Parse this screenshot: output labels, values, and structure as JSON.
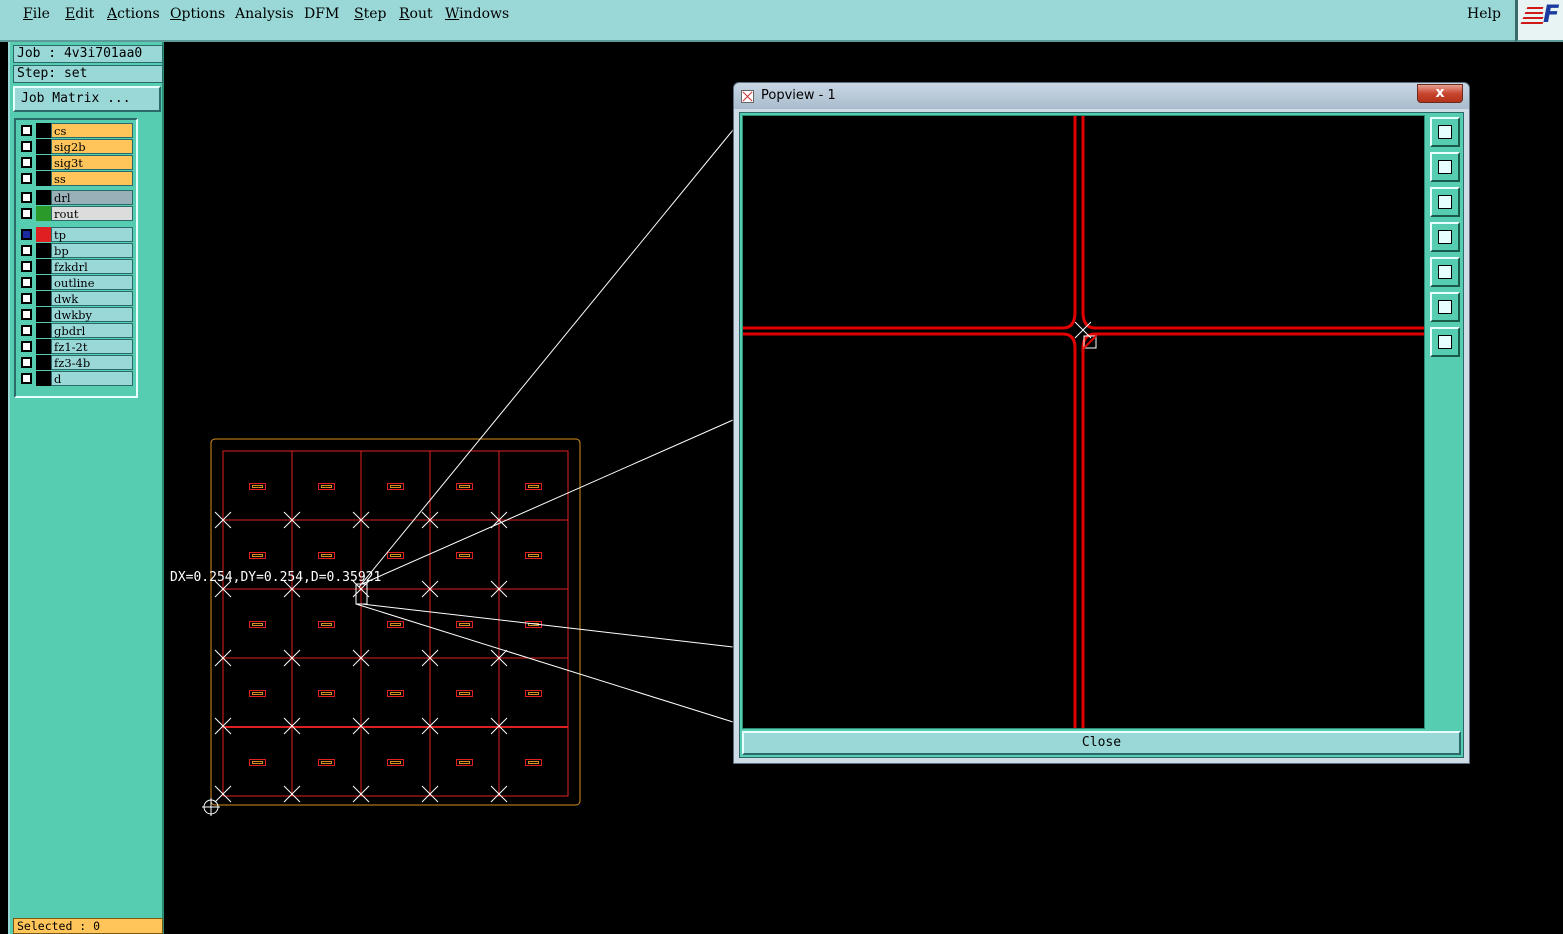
{
  "menubar": {
    "items": [
      {
        "label": "File",
        "u": "F",
        "rest": "ile"
      },
      {
        "label": "Edit",
        "u": "E",
        "rest": "dit"
      },
      {
        "label": "Actions",
        "u": "A",
        "rest": "ctions"
      },
      {
        "label": "Options",
        "u": "O",
        "rest": "ptions"
      },
      {
        "label": "Analysis",
        "u": "",
        "rest": "Analysis"
      },
      {
        "label": "DFM",
        "u": "",
        "rest": "DFM"
      },
      {
        "label": "Step",
        "u": "S",
        "rest": "tep"
      },
      {
        "label": "Rout",
        "u": "R",
        "rest": "out"
      },
      {
        "label": "Windows",
        "u": "W",
        "rest": "indows"
      }
    ],
    "help": "Help",
    "logo_text": "F"
  },
  "panel": {
    "job": "Job : 4v3i701aa0",
    "step": "Step: set",
    "job_matrix": "Job Matrix ...",
    "selected": "Selected : 0"
  },
  "layers": [
    {
      "name": "cs",
      "bg": "#ffc55a",
      "swatch": "#000000",
      "checked": false
    },
    {
      "name": "sig2b",
      "bg": "#ffc55a",
      "swatch": "#000000",
      "checked": false
    },
    {
      "name": "sig3t",
      "bg": "#ffc55a",
      "swatch": "#000000",
      "checked": false
    },
    {
      "name": "ss",
      "bg": "#ffc55a",
      "swatch": "#000000",
      "checked": false
    },
    {
      "name": "drl",
      "bg": "#9ab0b8",
      "swatch": "#000000",
      "checked": false
    },
    {
      "name": "rout",
      "bg": "#dcdcdc",
      "swatch": "#2a9a2a",
      "checked": false
    },
    {
      "name": "tp",
      "bg": "#9ad8d8",
      "swatch": "#e02020",
      "checked": true
    },
    {
      "name": "bp",
      "bg": "#9ad8d8",
      "swatch": "#000000",
      "checked": false
    },
    {
      "name": "fzkdrl",
      "bg": "#9ad8d8",
      "swatch": "#000000",
      "checked": false
    },
    {
      "name": "outline",
      "bg": "#9ad8d8",
      "swatch": "#000000",
      "checked": false
    },
    {
      "name": "dwk",
      "bg": "#9ad8d8",
      "swatch": "#000000",
      "checked": false
    },
    {
      "name": "dwkby",
      "bg": "#9ad8d8",
      "swatch": "#000000",
      "checked": false
    },
    {
      "name": "gbdrl",
      "bg": "#9ad8d8",
      "swatch": "#000000",
      "checked": false
    },
    {
      "name": "fz1-2t",
      "bg": "#9ad8d8",
      "swatch": "#000000",
      "checked": false
    },
    {
      "name": "fz3-4b",
      "bg": "#9ad8d8",
      "swatch": "#000000",
      "checked": false
    },
    {
      "name": "d",
      "bg": "#9ad8d8",
      "swatch": "#000000",
      "checked": false
    }
  ],
  "canvas": {
    "measure": "DX=0.254,DY=0.254,D=0.35921",
    "colors": {
      "outline": "#d89020",
      "grid": "#e02020",
      "marker": "#ffffff"
    }
  },
  "popview": {
    "title": "Popview - 1",
    "close_x": "x",
    "close_button": "Close",
    "tools": [
      "zoom-window-icon",
      "arrow-up-icon",
      "arrow-down-icon",
      "arrow-left-icon",
      "arrow-right-icon",
      "zoom-fit-icon",
      "zoom-home-icon"
    ]
  }
}
